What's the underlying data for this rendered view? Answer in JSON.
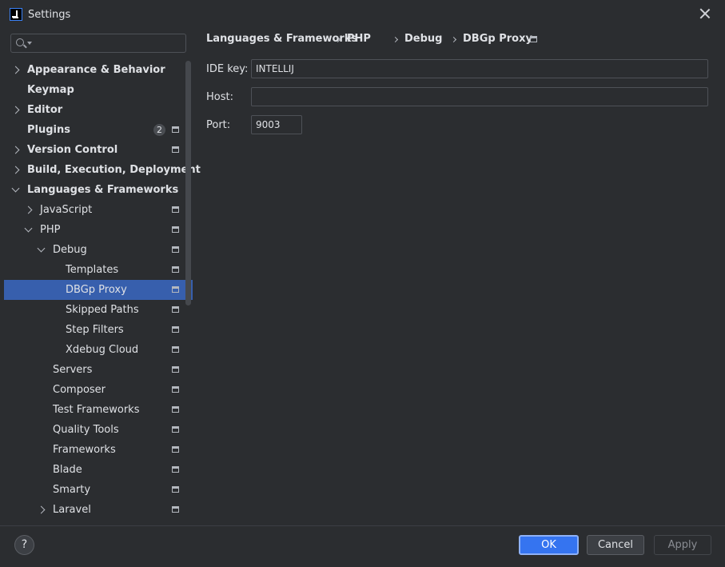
{
  "window": {
    "title": "Settings"
  },
  "search": {
    "placeholder": "",
    "value": ""
  },
  "tree": [
    {
      "label": "Appearance & Behavior",
      "bold": true,
      "level": 0,
      "arrow": "right",
      "icon": false
    },
    {
      "label": "Keymap",
      "bold": true,
      "level": 0,
      "arrow": "none",
      "icon": false
    },
    {
      "label": "Editor",
      "bold": true,
      "level": 0,
      "arrow": "right",
      "icon": false
    },
    {
      "label": "Plugins",
      "bold": true,
      "level": 0,
      "arrow": "none",
      "icon": true,
      "badge": "2"
    },
    {
      "label": "Version Control",
      "bold": true,
      "level": 0,
      "arrow": "right",
      "icon": true
    },
    {
      "label": "Build, Execution, Deployment",
      "bold": true,
      "level": 0,
      "arrow": "right",
      "icon": false
    },
    {
      "label": "Languages & Frameworks",
      "bold": true,
      "level": 0,
      "arrow": "down",
      "icon": false
    },
    {
      "label": "JavaScript",
      "bold": false,
      "level": 1,
      "arrow": "right",
      "icon": true
    },
    {
      "label": "PHP",
      "bold": false,
      "level": 1,
      "arrow": "down",
      "icon": true
    },
    {
      "label": "Debug",
      "bold": false,
      "level": 2,
      "arrow": "down",
      "icon": true
    },
    {
      "label": "Templates",
      "bold": false,
      "level": 3,
      "arrow": "none",
      "icon": true
    },
    {
      "label": "DBGp Proxy",
      "bold": false,
      "level": 3,
      "arrow": "none",
      "icon": true,
      "selected": true
    },
    {
      "label": "Skipped Paths",
      "bold": false,
      "level": 3,
      "arrow": "none",
      "icon": true
    },
    {
      "label": "Step Filters",
      "bold": false,
      "level": 3,
      "arrow": "none",
      "icon": true
    },
    {
      "label": "Xdebug Cloud",
      "bold": false,
      "level": 3,
      "arrow": "none",
      "icon": true
    },
    {
      "label": "Servers",
      "bold": false,
      "level": 2,
      "arrow": "none",
      "icon": true
    },
    {
      "label": "Composer",
      "bold": false,
      "level": 2,
      "arrow": "none",
      "icon": true
    },
    {
      "label": "Test Frameworks",
      "bold": false,
      "level": 2,
      "arrow": "none",
      "icon": true
    },
    {
      "label": "Quality Tools",
      "bold": false,
      "level": 2,
      "arrow": "none",
      "icon": true
    },
    {
      "label": "Frameworks",
      "bold": false,
      "level": 2,
      "arrow": "none",
      "icon": true
    },
    {
      "label": "Blade",
      "bold": false,
      "level": 2,
      "arrow": "none",
      "icon": true
    },
    {
      "label": "Smarty",
      "bold": false,
      "level": 2,
      "arrow": "none",
      "icon": true
    },
    {
      "label": "Laravel",
      "bold": false,
      "level": 2,
      "arrow": "right",
      "icon": true
    }
  ],
  "breadcrumb": [
    "Languages & Frameworks",
    "PHP",
    "Debug",
    "DBGp Proxy"
  ],
  "form": {
    "ide_key_label": "IDE key:",
    "ide_key_value": "INTELLIJ",
    "host_label": "Host:",
    "host_value": "",
    "port_label": "Port:",
    "port_value": "9003"
  },
  "footer": {
    "help_label": "?",
    "ok_label": "OK",
    "cancel_label": "Cancel",
    "apply_label": "Apply"
  },
  "colors": {
    "background": "#2b2d30",
    "selection": "#375fad",
    "primary_button": "#3574f0"
  }
}
